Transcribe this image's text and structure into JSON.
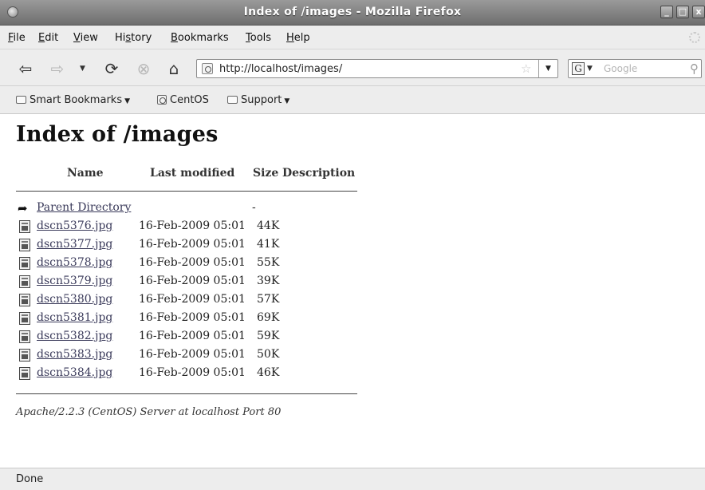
{
  "window": {
    "title": "Index of /images - Mozilla Firefox",
    "minimize": "_",
    "maximize": "□",
    "close": "x"
  },
  "menu": [
    {
      "accel": "F",
      "rest": "ile"
    },
    {
      "accel": "E",
      "rest": "dit"
    },
    {
      "accel": "V",
      "rest": "iew"
    },
    {
      "pre": "Hi",
      "accel": "s",
      "rest": "tory"
    },
    {
      "accel": "B",
      "rest": "ookmarks"
    },
    {
      "accel": "T",
      "rest": "ools"
    },
    {
      "accel": "H",
      "rest": "elp"
    }
  ],
  "nav": {
    "back": "⇦",
    "forward": "⇨",
    "dropdown": "▼",
    "reload": "⟳",
    "stop": "⊗",
    "home": "⌂",
    "url": "http://localhost/images/",
    "search_placeholder": "Google",
    "search_engine": "G"
  },
  "bookmarks": {
    "smart": "Smart Bookmarks",
    "centos": "CentOS",
    "support": "Support",
    "arrow": "▼"
  },
  "page": {
    "heading": "Index of /images",
    "columns": {
      "name": "Name",
      "last_modified": "Last modified",
      "size": "Size",
      "description": "Description"
    },
    "parent": {
      "name": "Parent Directory",
      "size": "-"
    },
    "files": [
      {
        "name": "dscn5376.jpg",
        "modified": "16-Feb-2009 05:01",
        "size": "44K"
      },
      {
        "name": "dscn5377.jpg",
        "modified": "16-Feb-2009 05:01",
        "size": "41K"
      },
      {
        "name": "dscn5378.jpg",
        "modified": "16-Feb-2009 05:01",
        "size": "55K"
      },
      {
        "name": "dscn5379.jpg",
        "modified": "16-Feb-2009 05:01",
        "size": "39K"
      },
      {
        "name": "dscn5380.jpg",
        "modified": "16-Feb-2009 05:01",
        "size": "57K"
      },
      {
        "name": "dscn5381.jpg",
        "modified": "16-Feb-2009 05:01",
        "size": "69K"
      },
      {
        "name": "dscn5382.jpg",
        "modified": "16-Feb-2009 05:01",
        "size": "59K"
      },
      {
        "name": "dscn5383.jpg",
        "modified": "16-Feb-2009 05:01",
        "size": "50K"
      },
      {
        "name": "dscn5384.jpg",
        "modified": "16-Feb-2009 05:01",
        "size": "46K"
      }
    ],
    "address": "Apache/2.2.3 (CentOS) Server at localhost Port 80"
  },
  "status": {
    "text": "Done"
  }
}
